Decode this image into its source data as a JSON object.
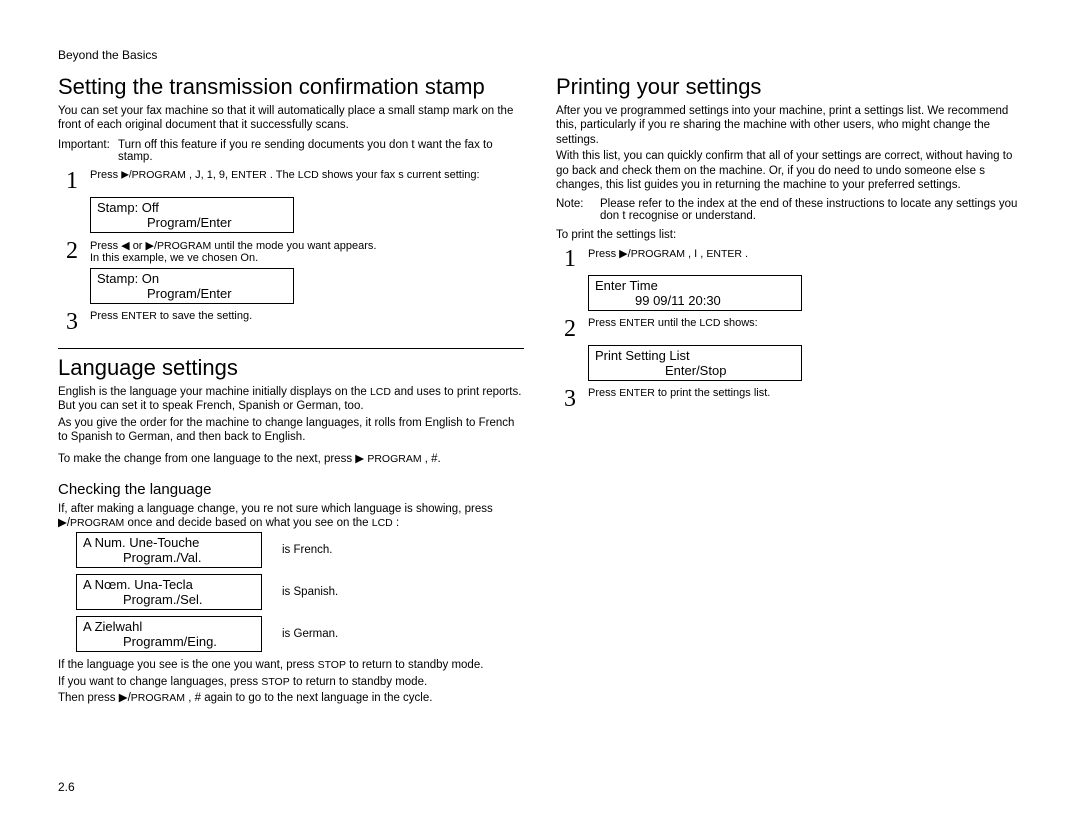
{
  "header": "Beyond the Basics",
  "pagenum": "2.6",
  "left": {
    "sec1": {
      "title": "Setting the transmission confirmation stamp",
      "p1a": "You can set your fax machine so that it will automatically place a small ",
      "p1b": "stamp mark",
      "p1c": " on the front of each  original  document that it successfully scans.",
      "important_label": "Important:",
      "important_text": "Turn off this feature if you re sending documents you don t want the fax to stamp.",
      "step1_a": "Press ",
      "step1_b": "▶/",
      "step1_c": "PROGRAM",
      "step1_d": "  , J, 1, 9, ",
      "step1_e": "ENTER",
      "step1_f": " . The ",
      "step1_g": "LCD",
      "step1_h": " shows your fax s current setting:",
      "lcd1_l1": "Stamp:          Off",
      "lcd1_l2": "Program/Enter",
      "step2_a": "Press  ◀ or ▶/",
      "step2_b": "PROGRAM",
      "step2_c": "  until the mode you want appears.",
      "step2_d": "In this example, we ve chosen  On.",
      "lcd2_l1": "Stamp:          On",
      "lcd2_l2": "Program/Enter",
      "step3_a": "Press ",
      "step3_b": "ENTER",
      "step3_c": "  to save the setting."
    },
    "sec2": {
      "title": "Language settings",
      "p1_a": "English is the language your machine initially displays on the ",
      "p1_b": "LCD",
      "p1_c": " and uses to print reports. But you can set it to  speak  French, Spanish or German, too.",
      "p2": "As you give the order for the machine to change languages, it  rolls  from English to French to Spanish to German, and then back to English.",
      "p3_a": "To make the change from one language to the next, press    ▶ ",
      "p3_b": "PROGRAM",
      "p3_c": "  , #.",
      "subtitle": "Checking the language",
      "p4_a": "If, after making a language change, you re not sure    which  language is showing, press  ▶/",
      "p4_b": "PROGRAM",
      "p4_c": "  once and decide based on what you see on the ",
      "p4_d": "LCD",
      "p4_e": " :",
      "lang": [
        {
          "l1": "A Num. Une-Touche",
          "l2": "Program./Val.",
          "label": "is French."
        },
        {
          "l1": "A Nœm. Una-Tecla",
          "l2": "Program./Sel.",
          "label": "is Spanish."
        },
        {
          "l1": "A Zielwahl",
          "l2": "Programm/Eing.",
          "label": "is German."
        }
      ],
      "p5_a": "If the language you see is the one you want, press ",
      "p5_b": "STOP",
      "p5_c": "  to return to standby mode.",
      "p6_a": "If you want to change languages, press ",
      "p6_b": "STOP",
      "p6_c": "  to return to standby mode.",
      "p7_a": "Then press  ▶/",
      "p7_b": "PROGRAM",
      "p7_c": "  , # again to go to the next language in the cycle."
    }
  },
  "right": {
    "sec1": {
      "title": "Printing your settings",
      "p1_a": "After you ve programmed settings into your machine, print a ",
      "p1_b": "settings list.",
      "p1_c": "  We recommend this, particularly if you re sharing the machine with other users, who might change the settings.",
      "p2": "With this list, you can quickly confirm that all of your settings are correct, without having to go back and check them on the machine. Or, if you    do need to undo someone else s changes, this list guides you in returning the machine to your preferred settings.",
      "note_label": "Note:",
      "note_text": "Please refer to the index at the end of these instructions to locate any settings you don t recognise or understand.",
      "p3": "To print the settings list:",
      "step1_a": "Press ▶/",
      "step1_b": "PROGRAM",
      "step1_c": "  , I , ",
      "step1_d": "ENTER",
      "step1_e": "  .",
      "lcd1_l1": "Enter Time",
      "lcd1_l2": "99 09/11 20:30",
      "step2_a": "Press ",
      "step2_b": "ENTER",
      "step2_c": "  until the ",
      "step2_d": "LCD",
      "step2_e": " shows:",
      "lcd2_l1": "Print Setting List",
      "lcd2_l2": "Enter/Stop",
      "step3_a": "Press ",
      "step3_b": "ENTER",
      "step3_c": "  to print the settings list."
    }
  }
}
